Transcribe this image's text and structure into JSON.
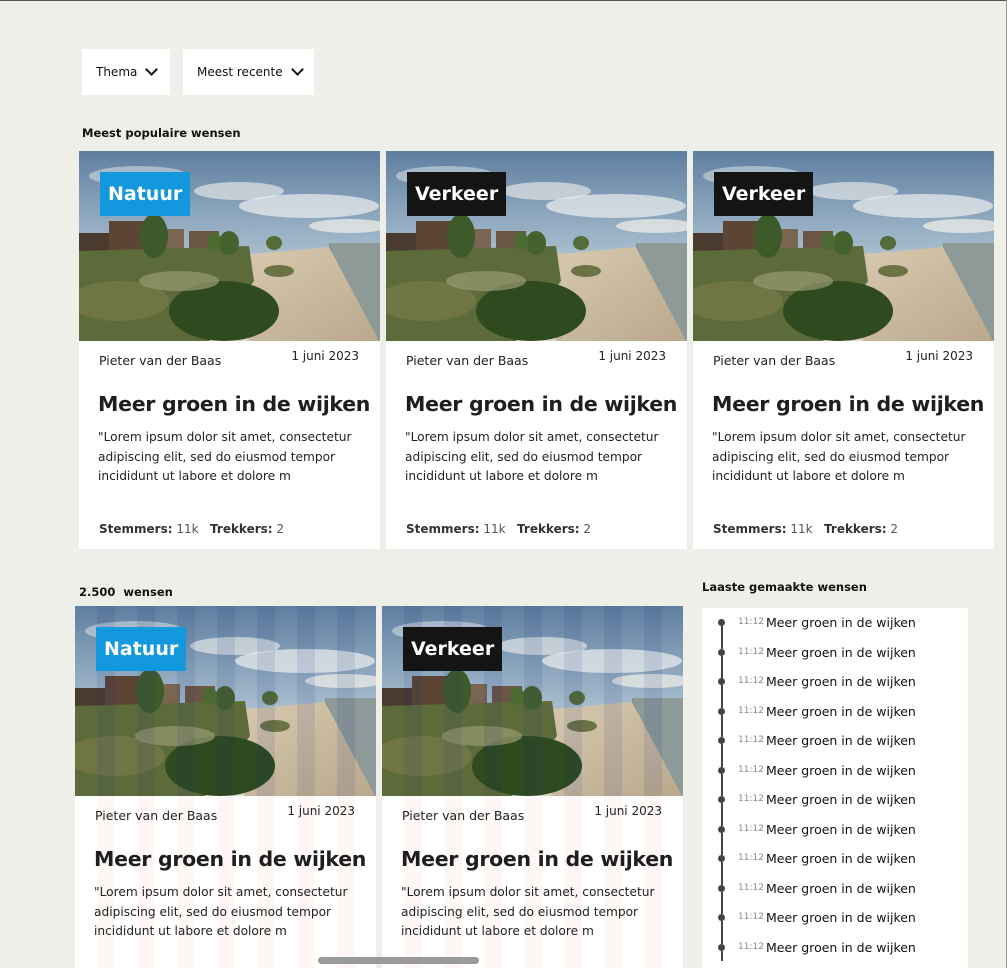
{
  "filters": {
    "theme_label": "Thema",
    "sort_label": "Meest recente"
  },
  "popular": {
    "heading": "Meest populaire wensen",
    "cards": [
      {
        "tag": "Natuur",
        "tag_color": "#1398de",
        "author": "Pieter van der Baas",
        "date": "1 juni 2023",
        "title": "Meer groen in de wijken",
        "body": "\"Lorem ipsum dolor sit amet, consectetur adipiscing elit, sed do eiusmod tempor incididunt ut labore et dolore m",
        "voters_label": "Stemmers:",
        "voters": "11k",
        "pullers_label": "Trekkers:",
        "pullers": "2"
      },
      {
        "tag": "Verkeer",
        "tag_color": "#141414",
        "author": "Pieter van der Baas",
        "date": "1 juni 2023",
        "title": "Meer groen in de wijken",
        "body": "\"Lorem ipsum dolor sit amet, consectetur adipiscing elit, sed do eiusmod tempor incididunt ut labore et dolore m",
        "voters_label": "Stemmers:",
        "voters": "11k",
        "pullers_label": "Trekkers:",
        "pullers": "2"
      },
      {
        "tag": "Verkeer",
        "tag_color": "#141414",
        "author": "Pieter van der Baas",
        "date": "1 juni 2023",
        "title": "Meer groen in de wijken",
        "body": "\"Lorem ipsum dolor sit amet, consectetur adipiscing elit, sed do eiusmod tempor incididunt ut labore et dolore m",
        "voters_label": "Stemmers:",
        "voters": "11k",
        "pullers_label": "Trekkers:",
        "pullers": "2"
      }
    ]
  },
  "all": {
    "heading": "2.500  wensen",
    "cards": [
      {
        "tag": "Natuur",
        "tag_color": "#1398de",
        "author": "Pieter van der Baas",
        "date": "1 juni 2023",
        "title": "Meer groen in de wijken",
        "body": "\"Lorem ipsum dolor sit amet, consectetur adipiscing elit, sed do eiusmod tempor incididunt ut labore et dolore m"
      },
      {
        "tag": "Verkeer",
        "tag_color": "#141414",
        "author": "Pieter van der Baas",
        "date": "1 juni 2023",
        "title": "Meer groen in de wijken",
        "body": "\"Lorem ipsum dolor sit amet, consectetur adipiscing elit, sed do eiusmod tempor incididunt ut labore et dolore m"
      }
    ]
  },
  "latest": {
    "heading": "Laaste gemaakte wensen",
    "items": [
      {
        "time": "11:12",
        "text": "Meer groen in de wijken"
      },
      {
        "time": "11:12",
        "text": "Meer groen in de wijken"
      },
      {
        "time": "11:12",
        "text": "Meer groen in de wijken"
      },
      {
        "time": "11:12",
        "text": "Meer groen in de wijken"
      },
      {
        "time": "11:12",
        "text": "Meer groen in de wijken"
      },
      {
        "time": "11:12",
        "text": "Meer groen in de wijken"
      },
      {
        "time": "11:12",
        "text": "Meer groen in de wijken"
      },
      {
        "time": "11:12",
        "text": "Meer groen in de wijken"
      },
      {
        "time": "11:12",
        "text": "Meer groen in de wijken"
      },
      {
        "time": "11:12",
        "text": "Meer groen in de wijken"
      },
      {
        "time": "11:12",
        "text": "Meer groen in de wijken"
      },
      {
        "time": "11:12",
        "text": "Meer groen in de wijken"
      }
    ]
  }
}
